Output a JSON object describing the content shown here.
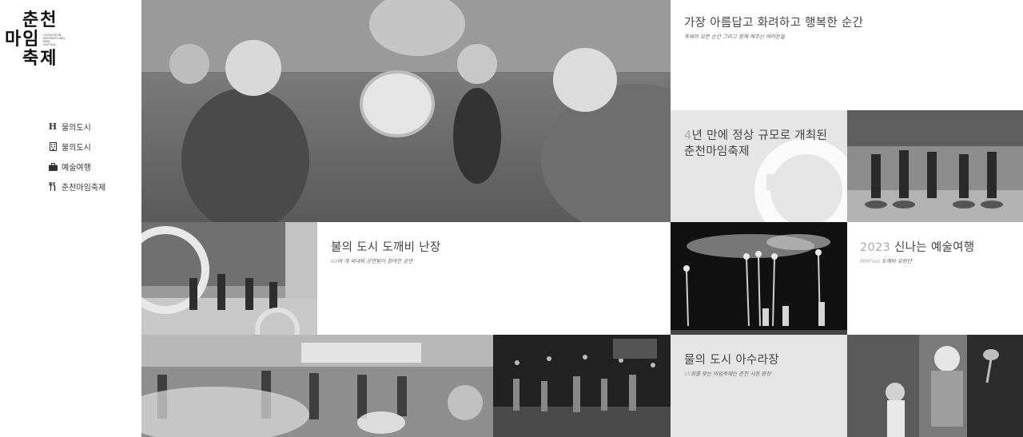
{
  "logo": {
    "line1": "춘천",
    "line2": "마임",
    "line3": "축제",
    "small": "CHUNCHEON INTERNATIONAL MIME FESTIVAL"
  },
  "nav": [
    {
      "icon": "H",
      "label": "물의도시"
    },
    {
      "icon": "building-icon",
      "label": "불의도시"
    },
    {
      "icon": "suitcase-icon",
      "label": "예술여행"
    },
    {
      "icon": "utensils-icon",
      "label": "춘천마임축제"
    }
  ],
  "captions": {
    "top_right": {
      "title": "가장 아름답고 화려하고 행복한 순간",
      "sub": "축제의 모든 순간 그리고 함께 해주신 여러분들"
    },
    "mid_gray": {
      "line1_hl": "4",
      "line1": "년 만에 정상 규모로 개최된",
      "line2": "춘천마임축제"
    },
    "fire_city": {
      "title": "불의 도시 도깨비 난장",
      "sub_hl": "60",
      "sub": "여 개 국내외 공연팀이 참여한 공연"
    },
    "art_trip": {
      "title_hl": "2023",
      "title": " 신나는 예술여행",
      "sub_hl": "MMFest",
      "sub": " 도깨비 유랑단"
    },
    "water_city": {
      "title": "물의 도시 아수라장",
      "sub_hl": "35",
      "sub": "회를 맞는 마임축제는 춘천 시청 광장"
    }
  }
}
